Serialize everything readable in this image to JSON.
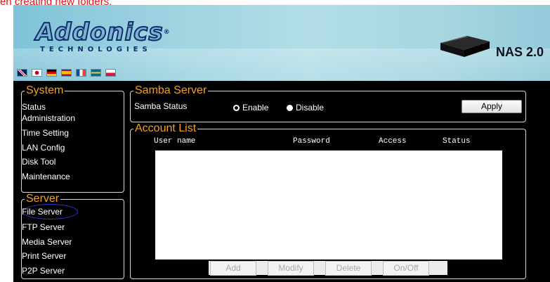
{
  "caption": "en creating new folders.",
  "logo": {
    "brand": "Addonics",
    "sub": "TECHNOLOGIES",
    "product": "NAS 2.0"
  },
  "flags": [
    "uk-flag-icon",
    "japan-flag-icon",
    "germany-flag-icon",
    "spain-flag-icon",
    "france-flag-icon",
    "sweden-flag-icon",
    "poland-flag-icon"
  ],
  "system": {
    "title": "System",
    "items": [
      "Status",
      "Administration",
      "Time Setting",
      "LAN Config",
      "Disk Tool",
      "Maintenance"
    ]
  },
  "server": {
    "title": "Server",
    "items": [
      "File Server",
      "FTP Server",
      "Media Server",
      "Print Server",
      "P2P Server"
    ]
  },
  "samba": {
    "title": "Samba Server",
    "status_label": "Samba Status",
    "enable": "Enable",
    "disable": "Disable",
    "selected": "Enable",
    "apply": "Apply"
  },
  "account": {
    "title": "Account List",
    "columns": [
      "User name",
      "Password",
      "Access",
      "Status"
    ],
    "rows": [],
    "buttons": [
      "Add",
      "Modify",
      "Delete",
      "On/Off"
    ]
  },
  "colors": {
    "accent": "#f0a020",
    "caption": "#e8141b",
    "background": "#000000"
  }
}
